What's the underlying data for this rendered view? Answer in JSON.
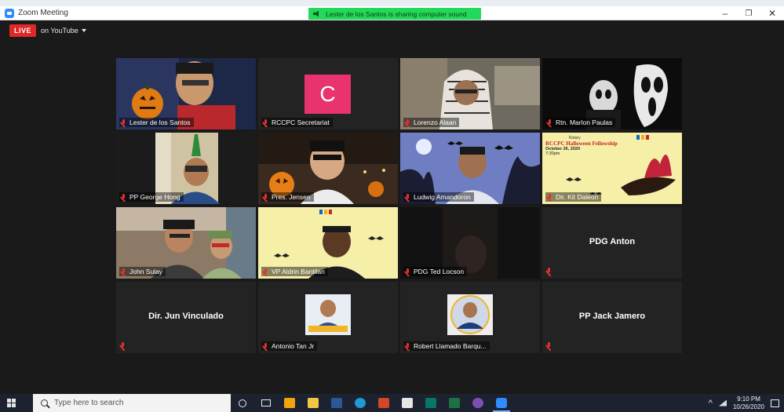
{
  "window": {
    "title": "Zoom Meeting",
    "minimize": "–",
    "restore": "❐",
    "close": "✕"
  },
  "notice": "Lester de los Santos is sharing computer sound",
  "live": {
    "badge": "LIVE",
    "destination": "on YouTube"
  },
  "participants": [
    {
      "name": "Lester de los Santos",
      "scene": "pumpkin-face"
    },
    {
      "name": "RCCPC Secretariat",
      "avatar_letter": "C",
      "avatar_color": "#e8336f"
    },
    {
      "name": "Lorenzo Alaan",
      "scene": "headscarf"
    },
    {
      "name": "Rtn. Marlon Paulas",
      "scene": "ghostface"
    },
    {
      "name": "PP George Hong",
      "scene": "masked"
    },
    {
      "name": "Pres. Jensen",
      "scene": "pumpkins",
      "active": true
    },
    {
      "name": "Ludwig Amandoron",
      "scene": "bats"
    },
    {
      "name": "Dir. Kit Daleon",
      "scene": "poster-witch"
    },
    {
      "name": "John Sulay",
      "scene": "pirates"
    },
    {
      "name": "VP Aldrin Bantilan",
      "scene": "poster-man"
    },
    {
      "name": "PDG Ted Locson",
      "scene": "dark"
    },
    {
      "name": "PDG Anton",
      "text_only": true
    },
    {
      "name": "Dir. Jun Vinculado",
      "text_only": true
    },
    {
      "name": "Antonio Tan Jr",
      "scene": "photo"
    },
    {
      "name": "Robert Llamado Barqu...",
      "scene": "photo-circle"
    },
    {
      "name": "PP Jack Jamero",
      "text_only": true
    }
  ],
  "poster": {
    "club": "Rotary",
    "title": "RCCPC Halloween Fellowship",
    "date": "October 26, 2020",
    "time": "7:30pm"
  },
  "taskbar": {
    "search_placeholder": "Type here to search",
    "apps": [
      "cortana-icon",
      "task-view-icon",
      "outlook-icon",
      "file-explorer-icon",
      "word-icon",
      "edge-icon",
      "powerpoint-icon",
      "store-icon",
      "publisher-icon",
      "excel-icon",
      "viber-icon",
      "zoom-icon"
    ],
    "time": "9:10 PM",
    "date": "10/26/2020",
    "caret": "^"
  },
  "colors": {
    "live": "#e02828",
    "notice": "#23d959",
    "active_border": "#b3e01a",
    "zoom_blue": "#2d8cff"
  }
}
